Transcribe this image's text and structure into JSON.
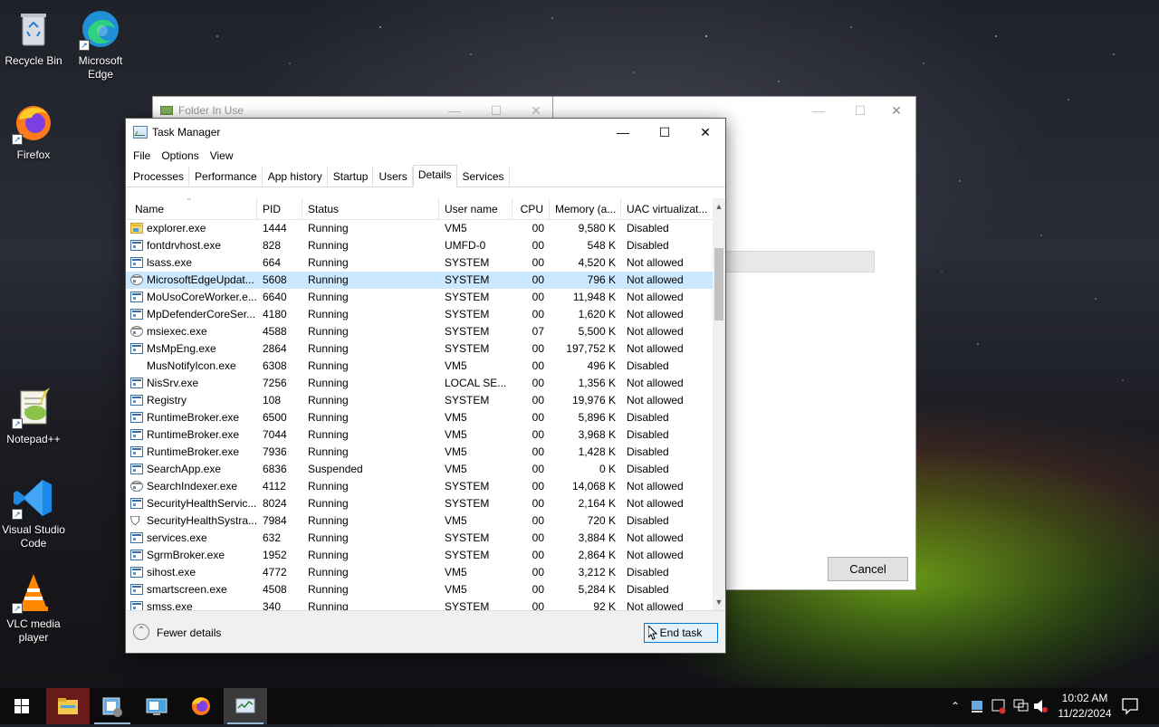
{
  "desktop": {
    "icons": [
      {
        "label": "Recycle Bin",
        "icon": "recycle-bin-icon"
      },
      {
        "label": "Microsoft Edge",
        "icon": "edge-icon"
      },
      {
        "label": "Firefox",
        "icon": "firefox-icon"
      },
      {
        "label": "Notepad++",
        "icon": "notepadpp-icon"
      },
      {
        "label": "Visual Studio Code",
        "icon": "vscode-icon"
      },
      {
        "label": "VLC media player",
        "icon": "vlc-icon"
      }
    ]
  },
  "folder_in_use": {
    "title": "Folder In Use",
    "cancel_label": "Cancel"
  },
  "task_manager": {
    "title": "Task Manager",
    "menu": [
      "File",
      "Options",
      "View"
    ],
    "tabs": [
      "Processes",
      "Performance",
      "App history",
      "Startup",
      "Users",
      "Details",
      "Services"
    ],
    "active_tab": "Details",
    "columns": [
      "Name",
      "PID",
      "Status",
      "User name",
      "CPU",
      "Memory (a...",
      "UAC virtualizat..."
    ],
    "rows": [
      {
        "name": "explorer.exe",
        "pid": "1444",
        "status": "Running",
        "user": "VM5",
        "cpu": "00",
        "mem": "9,580 K",
        "uac": "Disabled",
        "icon": "folder"
      },
      {
        "name": "fontdrvhost.exe",
        "pid": "828",
        "status": "Running",
        "user": "UMFD-0",
        "cpu": "00",
        "mem": "548 K",
        "uac": "Disabled",
        "icon": "app"
      },
      {
        "name": "lsass.exe",
        "pid": "664",
        "status": "Running",
        "user": "SYSTEM",
        "cpu": "00",
        "mem": "4,520 K",
        "uac": "Not allowed",
        "icon": "app"
      },
      {
        "name": "MicrosoftEdgeUpdat...",
        "pid": "5608",
        "status": "Running",
        "user": "SYSTEM",
        "cpu": "00",
        "mem": "796 K",
        "uac": "Not allowed",
        "icon": "gear",
        "selected": true
      },
      {
        "name": "MoUsoCoreWorker.e...",
        "pid": "6640",
        "status": "Running",
        "user": "SYSTEM",
        "cpu": "00",
        "mem": "11,948 K",
        "uac": "Not allowed",
        "icon": "app"
      },
      {
        "name": "MpDefenderCoreSer...",
        "pid": "4180",
        "status": "Running",
        "user": "SYSTEM",
        "cpu": "00",
        "mem": "1,620 K",
        "uac": "Not allowed",
        "icon": "app"
      },
      {
        "name": "msiexec.exe",
        "pid": "4588",
        "status": "Running",
        "user": "SYSTEM",
        "cpu": "07",
        "mem": "5,500 K",
        "uac": "Not allowed",
        "icon": "gear"
      },
      {
        "name": "MsMpEng.exe",
        "pid": "2864",
        "status": "Running",
        "user": "SYSTEM",
        "cpu": "00",
        "mem": "197,752 K",
        "uac": "Not allowed",
        "icon": "app"
      },
      {
        "name": "MusNotifyIcon.exe",
        "pid": "6308",
        "status": "Running",
        "user": "VM5",
        "cpu": "00",
        "mem": "496 K",
        "uac": "Disabled",
        "icon": "none"
      },
      {
        "name": "NisSrv.exe",
        "pid": "7256",
        "status": "Running",
        "user": "LOCAL SE...",
        "cpu": "00",
        "mem": "1,356 K",
        "uac": "Not allowed",
        "icon": "app"
      },
      {
        "name": "Registry",
        "pid": "108",
        "status": "Running",
        "user": "SYSTEM",
        "cpu": "00",
        "mem": "19,976 K",
        "uac": "Not allowed",
        "icon": "app"
      },
      {
        "name": "RuntimeBroker.exe",
        "pid": "6500",
        "status": "Running",
        "user": "VM5",
        "cpu": "00",
        "mem": "5,896 K",
        "uac": "Disabled",
        "icon": "app"
      },
      {
        "name": "RuntimeBroker.exe",
        "pid": "7044",
        "status": "Running",
        "user": "VM5",
        "cpu": "00",
        "mem": "3,968 K",
        "uac": "Disabled",
        "icon": "app"
      },
      {
        "name": "RuntimeBroker.exe",
        "pid": "7936",
        "status": "Running",
        "user": "VM5",
        "cpu": "00",
        "mem": "1,428 K",
        "uac": "Disabled",
        "icon": "app"
      },
      {
        "name": "SearchApp.exe",
        "pid": "6836",
        "status": "Suspended",
        "user": "VM5",
        "cpu": "00",
        "mem": "0 K",
        "uac": "Disabled",
        "icon": "app"
      },
      {
        "name": "SearchIndexer.exe",
        "pid": "4112",
        "status": "Running",
        "user": "SYSTEM",
        "cpu": "00",
        "mem": "14,068 K",
        "uac": "Not allowed",
        "icon": "gear"
      },
      {
        "name": "SecurityHealthServic...",
        "pid": "8024",
        "status": "Running",
        "user": "SYSTEM",
        "cpu": "00",
        "mem": "2,164 K",
        "uac": "Not allowed",
        "icon": "app"
      },
      {
        "name": "SecurityHealthSystra...",
        "pid": "7984",
        "status": "Running",
        "user": "VM5",
        "cpu": "00",
        "mem": "720 K",
        "uac": "Disabled",
        "icon": "shield"
      },
      {
        "name": "services.exe",
        "pid": "632",
        "status": "Running",
        "user": "SYSTEM",
        "cpu": "00",
        "mem": "3,884 K",
        "uac": "Not allowed",
        "icon": "app"
      },
      {
        "name": "SgrmBroker.exe",
        "pid": "1952",
        "status": "Running",
        "user": "SYSTEM",
        "cpu": "00",
        "mem": "2,864 K",
        "uac": "Not allowed",
        "icon": "app"
      },
      {
        "name": "sihost.exe",
        "pid": "4772",
        "status": "Running",
        "user": "VM5",
        "cpu": "00",
        "mem": "3,212 K",
        "uac": "Disabled",
        "icon": "app"
      },
      {
        "name": "smartscreen.exe",
        "pid": "4508",
        "status": "Running",
        "user": "VM5",
        "cpu": "00",
        "mem": "5,284 K",
        "uac": "Disabled",
        "icon": "app"
      },
      {
        "name": "smss.exe",
        "pid": "340",
        "status": "Running",
        "user": "SYSTEM",
        "cpu": "00",
        "mem": "92 K",
        "uac": "Not allowed",
        "icon": "app"
      }
    ],
    "footer": {
      "fewer_details_label": "Fewer details",
      "end_task_label": "End task"
    }
  },
  "taskbar": {
    "items": [
      "start-icon",
      "file-explorer-icon",
      "app-installer-icon",
      "monitor-icon",
      "firefox-icon",
      "task-manager-icon"
    ],
    "time": "10:02 AM",
    "date": "11/22/2024"
  },
  "colors": {
    "selection": "#cce8ff",
    "accent": "#0078d7"
  }
}
